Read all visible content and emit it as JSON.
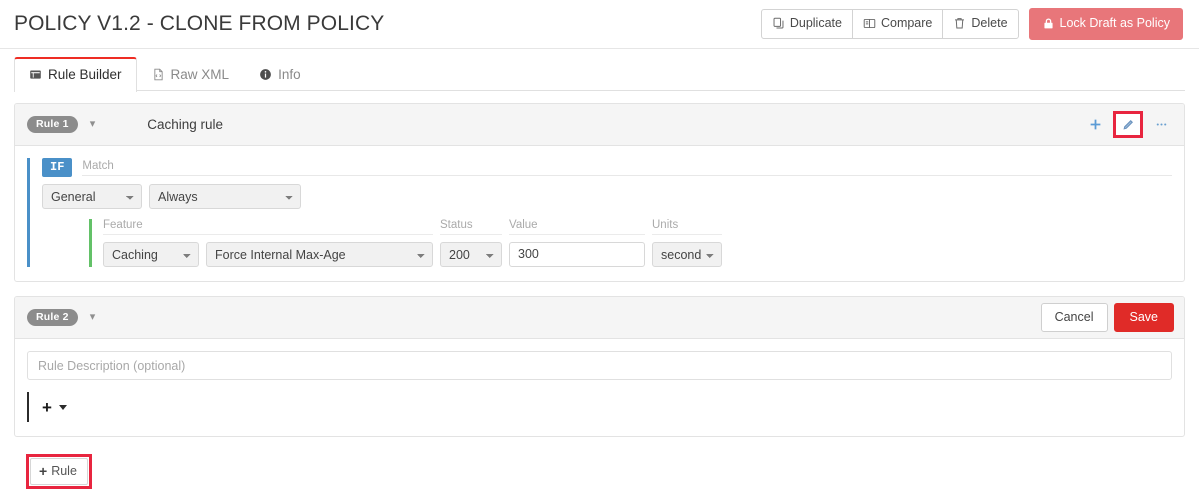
{
  "header": {
    "title": "POLICY V1.2 - CLONE FROM POLICY",
    "actions": [
      {
        "label": "Duplicate",
        "icon": "copy-icon"
      },
      {
        "label": "Compare",
        "icon": "compare-icon"
      },
      {
        "label": "Delete",
        "icon": "trash-icon"
      }
    ],
    "lock_button": {
      "label": "Lock Draft as Policy",
      "icon": "lock-icon",
      "color": "#e8767a"
    }
  },
  "tabs": [
    {
      "label": "Rule Builder",
      "icon": "window-icon",
      "active": true
    },
    {
      "label": "Raw XML",
      "icon": "xml-file-icon",
      "active": false
    },
    {
      "label": "Info",
      "icon": "info-icon",
      "active": false
    }
  ],
  "rules": [
    {
      "badge": "Rule 1",
      "name": "Caching rule",
      "head_icons": [
        {
          "name": "add-icon",
          "glyph": "+"
        },
        {
          "name": "edit-icon",
          "highlighted": true
        },
        {
          "name": "more-options-icon",
          "glyph": "···"
        }
      ],
      "condition": {
        "if_label": "IF",
        "match_label": "Match",
        "scope": {
          "value": "General",
          "options": [
            "General"
          ]
        },
        "operator": {
          "value": "Always",
          "options": [
            "Always"
          ]
        },
        "feature": {
          "labels": {
            "feature": "Feature",
            "status": "Status",
            "value": "Value",
            "units": "Units"
          },
          "category": {
            "value": "Caching",
            "options": [
              "Caching"
            ]
          },
          "action": {
            "value": "Force Internal Max-Age",
            "options": [
              "Force Internal Max-Age"
            ]
          },
          "status": {
            "value": "200",
            "options": [
              "200"
            ]
          },
          "value": "300",
          "units": {
            "value": "seconds",
            "options": [
              "seconds"
            ]
          }
        }
      }
    },
    {
      "badge": "Rule 2",
      "cancel_label": "Cancel",
      "save_label": "Save",
      "description_placeholder": "Rule Description (optional)",
      "description_value": "",
      "add_label": "+"
    }
  ],
  "add_rule_button": {
    "label": "Rule",
    "plus": "+",
    "highlighted": true
  },
  "colors": {
    "accent_red": "#e8253f",
    "save_red": "#e02b28",
    "lock_red": "#e8767a",
    "tab_red": "#ee2d24",
    "if_blue": "#4a90c8",
    "feature_green": "#63c168",
    "badge_gray": "#8c8c8c"
  }
}
